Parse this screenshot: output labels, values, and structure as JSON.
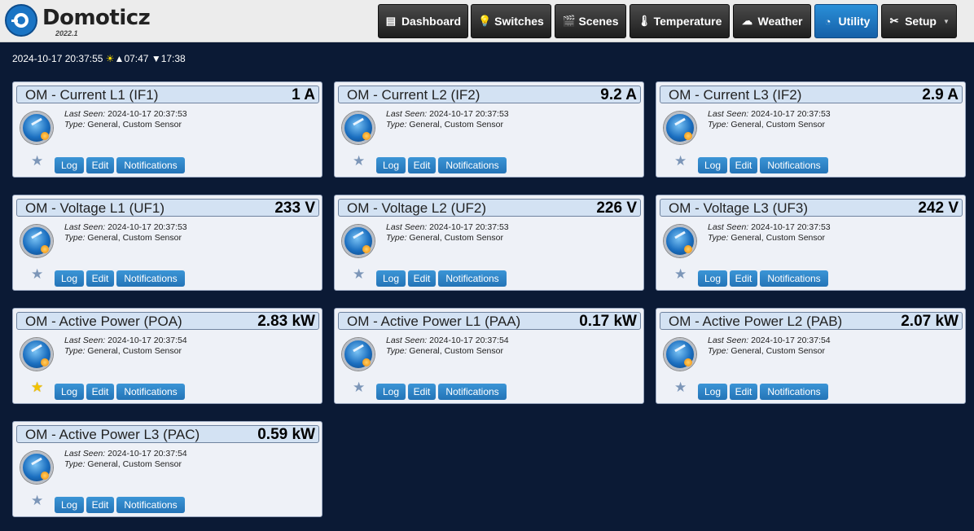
{
  "app": {
    "name": "Domoticz",
    "version": "2022.1"
  },
  "nav": [
    {
      "label": "Dashboard",
      "icon": "dashboard-icon",
      "glyph": "▤",
      "active": false
    },
    {
      "label": "Switches",
      "icon": "lightbulb-icon",
      "glyph": "💡",
      "active": false
    },
    {
      "label": "Scenes",
      "icon": "clapperboard-icon",
      "glyph": "🎬",
      "active": false
    },
    {
      "label": "Temperature",
      "icon": "thermometer-icon",
      "glyph": "🌡",
      "active": false
    },
    {
      "label": "Weather",
      "icon": "cloud-icon",
      "glyph": "☁",
      "active": false
    },
    {
      "label": "Utility",
      "icon": "gauge-icon",
      "glyph": "◔",
      "active": true
    },
    {
      "label": "Setup",
      "icon": "tools-icon",
      "glyph": "✂",
      "active": false
    }
  ],
  "status": {
    "datetime": "2024-10-17 20:37:55",
    "sunrise": "07:47",
    "sunset": "17:38",
    "sun_glyph": "☀",
    "rise_glyph": "▲",
    "set_glyph": "▼"
  },
  "labels": {
    "last_seen": "Last Seen:",
    "type": "Type:",
    "log": "Log",
    "edit": "Edit",
    "notifications": "Notifications"
  },
  "devices": [
    {
      "name": "OM - Current L1 (IF1)",
      "value": "1 A",
      "last_seen": "2024-10-17 20:37:53",
      "type": "General, Custom Sensor",
      "favorite": false
    },
    {
      "name": "OM - Current L2 (IF2)",
      "value": "9.2 A",
      "last_seen": "2024-10-17 20:37:53",
      "type": "General, Custom Sensor",
      "favorite": false
    },
    {
      "name": "OM - Current L3 (IF2)",
      "value": "2.9 A",
      "last_seen": "2024-10-17 20:37:53",
      "type": "General, Custom Sensor",
      "favorite": false
    },
    {
      "name": "OM - Voltage L1 (UF1)",
      "value": "233 V",
      "last_seen": "2024-10-17 20:37:53",
      "type": "General, Custom Sensor",
      "favorite": false
    },
    {
      "name": "OM - Voltage L2 (UF2)",
      "value": "226 V",
      "last_seen": "2024-10-17 20:37:53",
      "type": "General, Custom Sensor",
      "favorite": false
    },
    {
      "name": "OM - Voltage L3 (UF3)",
      "value": "242 V",
      "last_seen": "2024-10-17 20:37:53",
      "type": "General, Custom Sensor",
      "favorite": false
    },
    {
      "name": "OM - Active Power (POA)",
      "value": "2.83 kW",
      "last_seen": "2024-10-17 20:37:54",
      "type": "General, Custom Sensor",
      "favorite": true
    },
    {
      "name": "OM - Active Power L1 (PAA)",
      "value": "0.17 kW",
      "last_seen": "2024-10-17 20:37:54",
      "type": "General, Custom Sensor",
      "favorite": false
    },
    {
      "name": "OM - Active Power L2 (PAB)",
      "value": "2.07 kW",
      "last_seen": "2024-10-17 20:37:54",
      "type": "General, Custom Sensor",
      "favorite": false
    },
    {
      "name": "OM - Active Power L3 (PAC)",
      "value": "0.59 kW",
      "last_seen": "2024-10-17 20:37:54",
      "type": "General, Custom Sensor",
      "favorite": false
    }
  ],
  "colors": {
    "background": "#0b1a35",
    "accent": "#2474b7",
    "favorite": "#f2c200"
  }
}
